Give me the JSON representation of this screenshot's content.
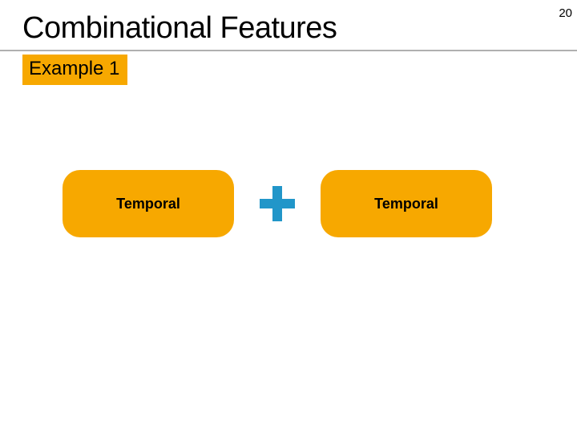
{
  "page_number": "20",
  "title": "Combinational Features",
  "example_label": "Example 1",
  "left_pill": {
    "label": "Temporal"
  },
  "right_pill": {
    "label": "Temporal"
  },
  "colors": {
    "accent_orange": "#f7a800",
    "plus_blue": "#2196c9"
  }
}
